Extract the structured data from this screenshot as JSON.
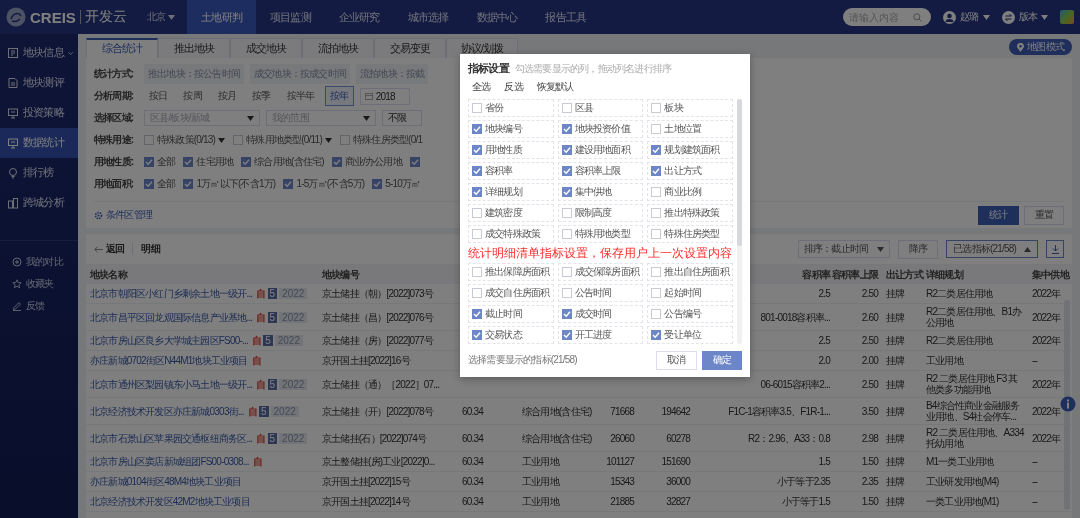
{
  "topbar": {
    "logo": "CREIS",
    "product": "开发云",
    "city": "北京",
    "nav": [
      {
        "label": "土地研判",
        "selected": true
      },
      {
        "label": "项目监测",
        "selected": false
      },
      {
        "label": "企业研究",
        "selected": false
      },
      {
        "label": "城市选择",
        "selected": false
      },
      {
        "label": "数据中心",
        "selected": false
      },
      {
        "label": "报告工具",
        "selected": false
      }
    ],
    "search": {
      "placeholder": "请输入内容"
    },
    "user": "赵璐",
    "version": "版本"
  },
  "sidebar": {
    "items": [
      {
        "label": "地块信息",
        "expandable": true,
        "selected": false
      },
      {
        "label": "地块测评",
        "expandable": false,
        "selected": false
      },
      {
        "label": "投资策略",
        "expandable": false,
        "selected": false
      },
      {
        "label": "数据统计",
        "expandable": false,
        "selected": true
      },
      {
        "label": "排行榜",
        "expandable": false,
        "selected": false
      },
      {
        "label": "跨城分析",
        "expandable": false,
        "selected": false
      }
    ],
    "links": [
      "我的对比",
      "收藏夹",
      "反馈"
    ]
  },
  "tabs": [
    {
      "label": "综合统计",
      "selected": true
    },
    {
      "label": "推出地块",
      "selected": false
    },
    {
      "label": "成交地块",
      "selected": false
    },
    {
      "label": "流拍地块",
      "selected": false
    },
    {
      "label": "交易变更",
      "selected": false
    },
    {
      "label": "协议/划拨",
      "selected": false
    }
  ],
  "map_button": "地图模式",
  "filters": [
    {
      "label": "统计方式:",
      "kind": "chips",
      "options": [
        {
          "label": "推出地块：按公告时间"
        },
        {
          "label": "成交地块：按成交时间"
        },
        {
          "label": "流拍地块：按截"
        }
      ]
    },
    {
      "label": "分析周期:",
      "kind": "periods",
      "options": [
        {
          "label": "按日",
          "selected": false
        },
        {
          "label": "按周",
          "selected": false
        },
        {
          "label": "按月",
          "selected": false
        },
        {
          "label": "按季",
          "selected": false
        },
        {
          "label": "按半年",
          "selected": false
        },
        {
          "label": "按年",
          "selected": true
        }
      ],
      "year": "2018"
    },
    {
      "label": "选择区域:",
      "kind": "selects",
      "options": [
        {
          "placeholder": "区县/板块/新城"
        },
        {
          "placeholder": "我的范围"
        },
        {
          "value": "不限"
        }
      ]
    },
    {
      "label": "特殊用途:",
      "kind": "checkboxes",
      "options": [
        {
          "label": "特殊政策(0/13)",
          "checked": false,
          "dropdown": true
        },
        {
          "label": "特殊用地类型(0/11)",
          "checked": false,
          "dropdown": true
        },
        {
          "label": "特殊住房类型(0/1",
          "checked": false,
          "dropdown": false
        }
      ]
    },
    {
      "label": "用地性质:",
      "kind": "checkboxes",
      "options": [
        {
          "label": "全部",
          "checked": true,
          "dropdown": false
        },
        {
          "label": "住宅用地",
          "checked": true,
          "dropdown": false
        },
        {
          "label": "综合用地(含住宅)",
          "checked": true,
          "dropdown": false
        },
        {
          "label": "商业/办公用地",
          "checked": true,
          "dropdown": false
        },
        {
          "checked": true
        }
      ]
    },
    {
      "label": "用地面积:",
      "kind": "checkboxes",
      "options": [
        {
          "label": "全部",
          "checked": true,
          "dropdown": false
        },
        {
          "label": "1万㎡以下(不含1万)",
          "checked": true,
          "dropdown": false
        },
        {
          "label": "1-5万㎡(不含5万)",
          "checked": true,
          "dropdown": false
        },
        {
          "label": "5-10万㎡",
          "checked": true,
          "dropdown": false
        }
      ]
    }
  ],
  "condition_manager": "条件区管理",
  "actions": [
    {
      "label": "统计",
      "primary": true
    },
    {
      "label": "重置",
      "primary": false
    }
  ],
  "detail_bar": {
    "back": "返回",
    "title": "明细",
    "sort": "排序：截止时间",
    "order": "降序",
    "indicators": "已选指标(21/58)"
  },
  "table": {
    "header": {
      "name": "地块名称",
      "code": "地块编号",
      "far": "容积率",
      "far_max": "容积率上限",
      "method": "出让方式",
      "plan": "详细规划",
      "supply": "集中供地"
    },
    "rows": [
      {
        "name": "北京市朝阳区小红门乡剩余土地一级开...",
        "tag": "自",
        "badge": "5",
        "year": "2022",
        "code": "京土储挂（朝）[2022]073号",
        "far": "2.5",
        "far_max": "2.50",
        "method": "挂牌",
        "plan": "R2二类居住用地",
        "supply": "2022年"
      },
      {
        "name": "北京市昌平区回龙观国际信息产业基地...",
        "tag": "自",
        "badge": "5",
        "year": "2022",
        "code": "京土储挂（昌）[2022]076号",
        "far": "801-0018容积率...",
        "far_max": "2.60",
        "method": "挂牌",
        "plan": "R2二类居住用地、B1办公用地",
        "supply": "2022年"
      },
      {
        "name": "北京市房山区良乡大学城主园区FS00-...",
        "tag": "自",
        "badge": "5",
        "year": "2022",
        "code": "京土储挂（房）[2022]077号",
        "far": "2.5",
        "far_max": "2.50",
        "method": "挂牌",
        "plan": "R2二类居住用地",
        "supply": "2022年"
      },
      {
        "name": "亦庄新城0702街区N44M1地块工业项目",
        "tag": "自",
        "code": "京开国土挂[2022]16号",
        "far": "2.0",
        "far_max": "2.00",
        "method": "挂牌",
        "plan": "工业用地",
        "supply": "--"
      },
      {
        "name": "北京市通州区梨园镇东小马土地一级开...",
        "tag": "自",
        "badge": "5",
        "year": "2022",
        "code": "京土储挂（通）［2022］07...",
        "far": "06-6015容积率2...",
        "far_max": "2.50",
        "method": "挂牌",
        "plan": "R2 二类居住用地 F3 其他类多功能用地",
        "supply": "2022年"
      },
      {
        "name": "北京经济技术开发区亦庄新城0303街...",
        "tag": "自",
        "badge": "5",
        "year": "2022",
        "code": "京土储挂（开）[2022]078号",
        "invest": "60.34",
        "use": "综合用地(含住宅)",
        "area": "71668",
        "gfa": "194642",
        "far": "F1C-1容积率3.5、F1R-1...",
        "far_max": "3.50",
        "method": "挂牌",
        "plan": "B4综合性商业金融服务业用地、S4社会停车...",
        "supply": "2022年"
      },
      {
        "name": "北京市石景山区苹果园交通枢纽商务区...",
        "tag": "自",
        "badge": "5",
        "year": "2022",
        "code": "京土储挂(石）[2022]074号",
        "invest": "60.34",
        "use": "综合用地(含住宅)",
        "area": "26060",
        "gfa": "60278",
        "far": "R2：2.96、A33：0.8",
        "far_max": "2.98",
        "method": "挂牌",
        "plan": "R2 二类居住用地、A334 托幼用地",
        "supply": "2022年"
      },
      {
        "name": "北京市房山区窦店新城组团FS00-0308...",
        "tag": "自",
        "code": "京土整储挂(房)工业[2022]0...",
        "invest": "60.34",
        "use": "工业用地",
        "area": "101127",
        "gfa": "151690",
        "far": "1.5",
        "far_max": "1.50",
        "method": "挂牌",
        "plan": "M1一类工业用地",
        "supply": "--"
      },
      {
        "name": "亦庄新城0104街区48M4地块工业项目",
        "code": "京开国土挂[2022]15号",
        "invest": "60.34",
        "use": "工业用地",
        "area": "15343",
        "gfa": "36000",
        "far": "小于等于2.35",
        "far_max": "2.35",
        "method": "挂牌",
        "plan": "工业研发用地(M4)",
        "supply": "--"
      },
      {
        "name": "北京经济技术开发区42M2地块工业项目",
        "code": "京开国土挂[2022]14号",
        "invest": "60.34",
        "use": "工业用地",
        "area": "21885",
        "gfa": "32827",
        "far": "小于等于1.5",
        "far_max": "1.50",
        "method": "挂牌",
        "plan": "一类工业用地(M1)",
        "supply": "--"
      }
    ]
  },
  "dialog": {
    "title": "指标设置",
    "hint": "勾选需要显示的列，拖动列名进行排序",
    "links": [
      "全选",
      "反选",
      "恢复默认"
    ],
    "items": [
      {
        "label": "省份",
        "checked": false
      },
      {
        "label": "区县",
        "checked": false
      },
      {
        "label": "板块",
        "checked": false
      },
      {
        "label": "地块编号",
        "checked": true
      },
      {
        "label": "地块投资价值",
        "checked": true
      },
      {
        "label": "土地位置",
        "checked": false
      },
      {
        "label": "用地性质",
        "checked": true
      },
      {
        "label": "建设用地面积",
        "checked": true
      },
      {
        "label": "规划建筑面积",
        "checked": true
      },
      {
        "label": "容积率",
        "checked": true
      },
      {
        "label": "容积率上限",
        "checked": true
      },
      {
        "label": "出让方式",
        "checked": true
      },
      {
        "label": "详细规划",
        "checked": true
      },
      {
        "label": "集中供地",
        "checked": true
      },
      {
        "label": "商业比例",
        "checked": false
      },
      {
        "label": "建筑密度",
        "checked": false
      },
      {
        "label": "限制高度",
        "checked": false
      },
      {
        "label": "推出特殊政策",
        "checked": false
      },
      {
        "label": "成交特殊政策",
        "checked": false
      },
      {
        "label": "特殊用地类型",
        "checked": false
      },
      {
        "label": "特殊住房类型",
        "checked": false
      },
      {
        "label": "推出保障房面积",
        "checked": false
      },
      {
        "label": "成交保障房面积",
        "checked": false
      },
      {
        "label": "推出自住房面积",
        "checked": false
      },
      {
        "label": "成交自住房面积",
        "checked": false
      },
      {
        "label": "公告时间",
        "checked": false
      },
      {
        "label": "起始时间",
        "checked": false
      },
      {
        "label": "截止时间",
        "checked": true
      },
      {
        "label": "成交时间",
        "checked": true
      },
      {
        "label": "公告编号",
        "checked": false
      },
      {
        "label": "交易状态",
        "checked": true
      },
      {
        "label": "开工进度",
        "checked": true
      },
      {
        "label": "受让单位",
        "checked": true
      }
    ],
    "footer": "选择需要显示的指标(21/58)",
    "cancel": "取消",
    "confirm": "确定"
  },
  "annotation": "统计明细清单指标设置，保存用户上一次设置内容"
}
